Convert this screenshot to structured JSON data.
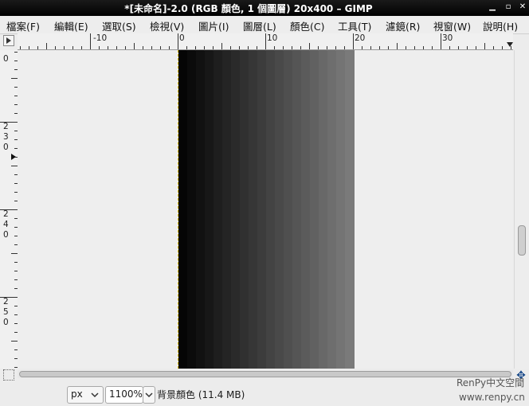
{
  "window": {
    "title": "*[未命名]-2.0 (RGB 顏色, 1 個圖層) 20x400 – GIMP"
  },
  "menu": [
    {
      "label": "檔案(F)",
      "name": "menu-file"
    },
    {
      "label": "編輯(E)",
      "name": "menu-edit"
    },
    {
      "label": "選取(S)",
      "name": "menu-select"
    },
    {
      "label": "檢視(V)",
      "name": "menu-view"
    },
    {
      "label": "圖片(I)",
      "name": "menu-image"
    },
    {
      "label": "圖層(L)",
      "name": "menu-layer"
    },
    {
      "label": "顏色(C)",
      "name": "menu-colors"
    },
    {
      "label": "工具(T)",
      "name": "menu-tools"
    },
    {
      "label": "濾鏡(R)",
      "name": "menu-filters"
    },
    {
      "label": "視窗(W)",
      "name": "menu-windows"
    },
    {
      "label": "說明(H)",
      "name": "menu-help"
    }
  ],
  "ruler": {
    "horizontal": [
      "-10",
      "0",
      "10",
      "20",
      "30"
    ],
    "vertical": [
      [
        "2",
        "2",
        "0"
      ],
      [
        "2",
        "3",
        "0"
      ],
      [
        "2",
        "4",
        "0"
      ],
      [
        "2",
        "5",
        "0"
      ]
    ]
  },
  "image": {
    "gradient_start": "#050505",
    "gradient_end": "#7a7a7a",
    "band_count": 20
  },
  "status": {
    "unit": "px",
    "zoom": "1100%",
    "message": "背景顏色 (11.4 MB)"
  },
  "watermark": {
    "line1": "RenPy中文空間",
    "line2": "www.renpy.cn"
  },
  "icons": {
    "menu_triangle": "play-right-icon",
    "navigate": "navigate-icon",
    "quick_mask": "quick-mask-icon"
  }
}
